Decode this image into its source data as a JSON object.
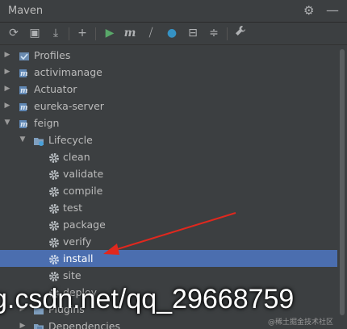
{
  "window": {
    "title": "Maven"
  },
  "titlebar_icons": {
    "settings": "gear-icon",
    "hide": "minimize-icon"
  },
  "toolbar": {
    "buttons": [
      {
        "name": "reload-icon",
        "glyph": "⟳"
      },
      {
        "name": "generate-sources-icon",
        "glyph": "▣"
      },
      {
        "name": "download-icon",
        "glyph": "⤓"
      },
      {
        "name": "add-icon",
        "glyph": "+"
      },
      {
        "name": "run-icon",
        "glyph": "▶"
      },
      {
        "name": "execute-goal-icon",
        "glyph": "m"
      },
      {
        "name": "skip-tests-icon",
        "glyph": "⧸"
      },
      {
        "name": "offline-mode-icon",
        "glyph": "●"
      },
      {
        "name": "show-dependencies-icon",
        "glyph": "⊟"
      },
      {
        "name": "collapse-all-icon",
        "glyph": "≑"
      },
      {
        "name": "settings-wrench-icon",
        "glyph": "🔧"
      }
    ]
  },
  "tree": {
    "rows": [
      {
        "label": "Profiles",
        "icon": "profiles-icon",
        "arrow": "▶"
      },
      {
        "label": "activimanage",
        "icon": "maven-project-icon",
        "arrow": "▶"
      },
      {
        "label": "Actuator",
        "icon": "maven-project-icon",
        "arrow": "▶"
      },
      {
        "label": "eureka-server",
        "icon": "maven-project-icon",
        "arrow": "▶"
      },
      {
        "label": "feign",
        "icon": "maven-project-icon",
        "arrow": "▼"
      },
      {
        "label": "Lifecycle",
        "icon": "lifecycle-folder-icon",
        "arrow": "▼"
      },
      {
        "label": "clean",
        "icon": "gear-icon"
      },
      {
        "label": "validate",
        "icon": "gear-icon"
      },
      {
        "label": "compile",
        "icon": "gear-icon"
      },
      {
        "label": "test",
        "icon": "gear-icon"
      },
      {
        "label": "package",
        "icon": "gear-icon"
      },
      {
        "label": "verify",
        "icon": "gear-icon"
      },
      {
        "label": "install",
        "icon": "gear-icon",
        "selected": true
      },
      {
        "label": "site",
        "icon": "gear-icon"
      },
      {
        "label": "deploy",
        "icon": "gear-icon"
      },
      {
        "label": "Plugins",
        "icon": "plugins-folder-icon",
        "arrow": "▶"
      },
      {
        "label": "Dependencies",
        "icon": "dependencies-folder-icon",
        "arrow": "▶"
      }
    ]
  },
  "overlay": {
    "watermark": "g.csdn.net/qq_29668759",
    "corner_watermark": "@稀土掘金技术社区"
  },
  "colors": {
    "background": "#3c3f41",
    "selection": "#4b6eaf",
    "annotation_arrow": "#e0281e"
  }
}
